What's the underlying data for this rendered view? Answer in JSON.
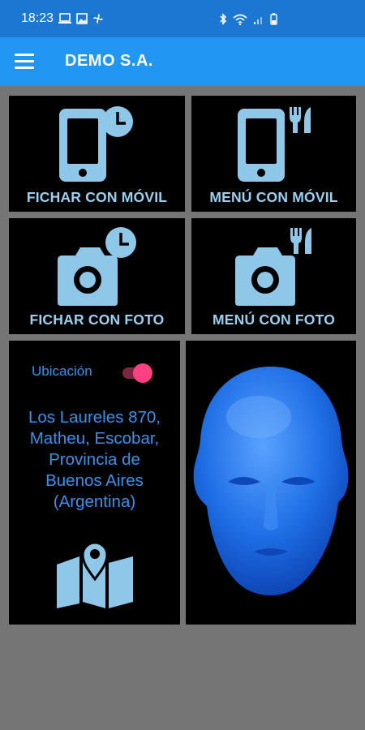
{
  "status_bar": {
    "time": "18:23",
    "icons_left": [
      "laptop-icon",
      "image-icon",
      "fan-icon"
    ],
    "icons_right": [
      "bluetooth-icon",
      "wifi-icon",
      "signal-icon",
      "battery-icon"
    ]
  },
  "app_bar": {
    "title": "DEMO S.A.",
    "menu_icon": "hamburger-menu-icon",
    "color": "#2196f3"
  },
  "tiles": [
    {
      "label": "FICHAR CON MÓVIL",
      "icon": "phone-clock-icon"
    },
    {
      "label": "MENÚ CON MÓVIL",
      "icon": "phone-cutlery-icon"
    },
    {
      "label": "FICHAR CON FOTO",
      "icon": "camera-clock-icon"
    },
    {
      "label": "MENÚ CON FOTO",
      "icon": "camera-cutlery-icon"
    }
  ],
  "location": {
    "label": "Ubicación",
    "toggle_on": true,
    "address": "Los Laureles 870,\nMatheu, Escobar,\nProvincia de\nBuenos Aires\n(Argentina)",
    "icon": "map-pin-icon"
  },
  "face_panel": {
    "icon": "blue-head-image"
  },
  "colors": {
    "status_bar": "#1c77d2",
    "tile_bg": "#000000",
    "tile_text": "#9bd0ef",
    "accent_pink": "#ff4081",
    "page_bg": "#757575"
  }
}
